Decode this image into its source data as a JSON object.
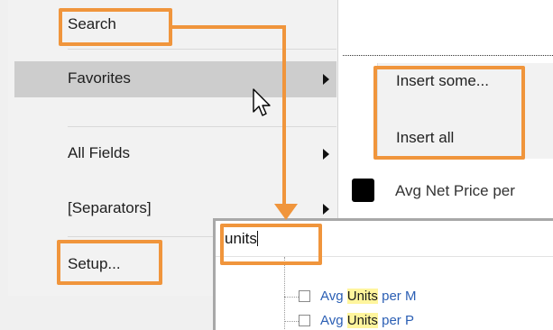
{
  "menu": {
    "items": [
      {
        "label": "Search",
        "has_submenu": false
      },
      {
        "label": "Favorites",
        "has_submenu": true
      },
      {
        "label": "All Fields",
        "has_submenu": true
      },
      {
        "label": "[Separators]",
        "has_submenu": true
      },
      {
        "label": "Setup...",
        "has_submenu": false
      }
    ]
  },
  "favorites_submenu": {
    "items": [
      "Insert some...",
      "Insert all"
    ]
  },
  "field_list": {
    "visible_item": "Avg Net Price per"
  },
  "search_popup": {
    "query": "units",
    "results": [
      {
        "prefix": "Avg ",
        "match": "Units",
        "suffix": " per M"
      },
      {
        "prefix": "Avg ",
        "match": "Units",
        "suffix": " per P"
      }
    ]
  },
  "colors": {
    "callout": "#f0953c",
    "menu_bg": "#f2f2f2",
    "menu_highlight": "#cdcdcd",
    "result_link": "#2b5fb4",
    "match_highlight": "#fff59d"
  }
}
